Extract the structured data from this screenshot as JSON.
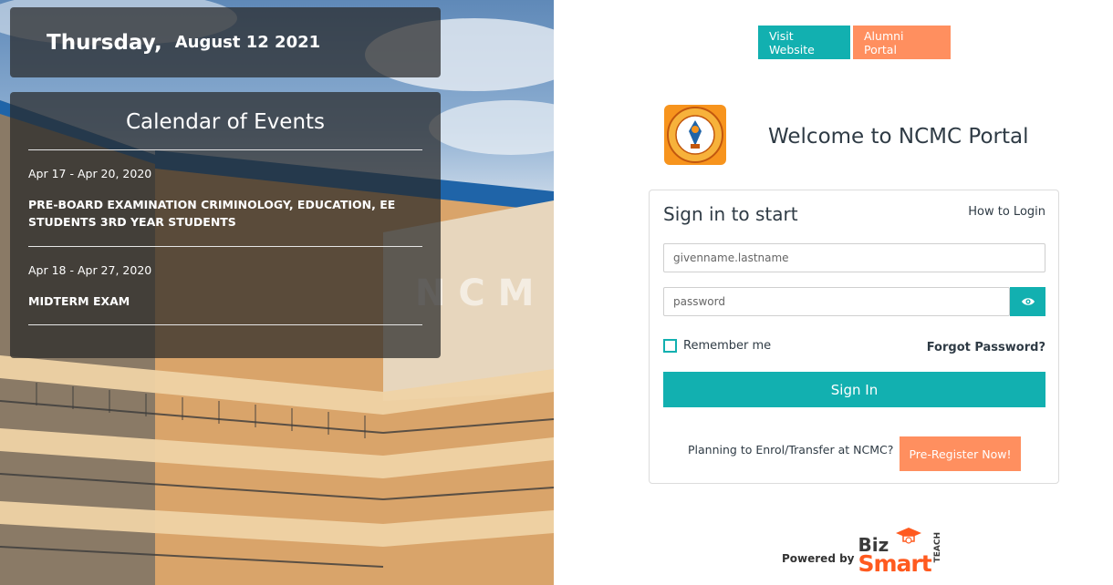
{
  "date": {
    "day": "Thursday,",
    "rest": "August 12 2021"
  },
  "events": {
    "title": "Calendar of Events",
    "items": [
      {
        "range": "Apr 17 - Apr 20, 2020",
        "name": "PRE-BOARD EXAMINATION CRIMINOLOGY, EDUCATION, EE STUDENTS 3RD YEAR STUDENTS"
      },
      {
        "range": "Apr 18 - Apr 27, 2020",
        "name": "MIDTERM EXAM"
      }
    ]
  },
  "photo": {
    "building_letters": "N C M"
  },
  "top_links": {
    "visit": "Visit Website",
    "alumni": "Alumni Portal"
  },
  "header": {
    "welcome": "Welcome to NCMC Portal"
  },
  "login": {
    "title": "Sign in to start",
    "how_to": "How to Login",
    "username_placeholder": "givenname.lastname",
    "password_placeholder": "password",
    "remember": "Remember me",
    "forgot": "Forgot Password?",
    "signin": "Sign In",
    "planning": "Planning to Enrol/Transfer at NCMC?",
    "preregister": "Pre-Register Now!"
  },
  "footer": {
    "powered_by": "Powered by",
    "brand_biz": "Biz",
    "brand_smart": "Smart",
    "brand_teach": "TEACH"
  },
  "colors": {
    "teal": "#12b0b0",
    "orange": "#ff8f5f",
    "text_dark": "#2f3b45"
  }
}
